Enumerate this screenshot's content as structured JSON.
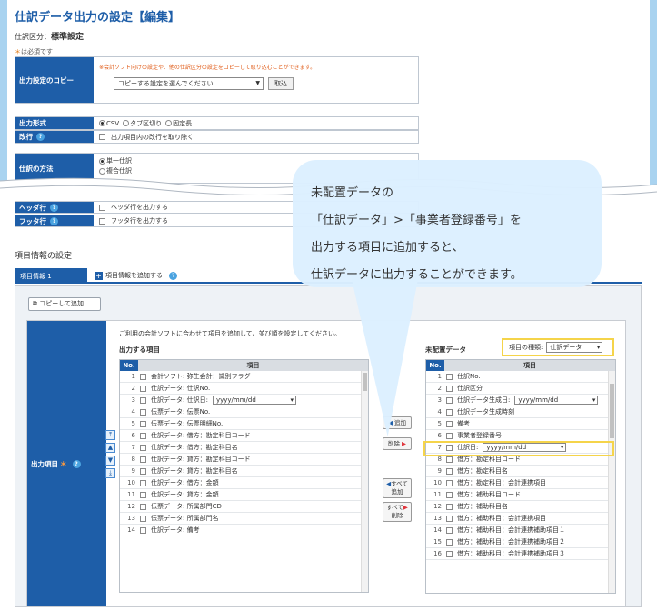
{
  "header": {
    "title": "仕訳データ出力の設定【編集】",
    "category_label": "仕訳区分：",
    "category_value": "標準設定",
    "required_note": "は必須です"
  },
  "copy": {
    "label": "出力設定のコピー",
    "note": "※会計ソフト向けの設定や、他の仕訳区分の設定をコピーして取り込むことができます。",
    "select": "コピーする設定を選んでください",
    "button": "取込"
  },
  "format": {
    "label": "出力形式",
    "opt1": "CSV",
    "opt2": "タブ区切り",
    "opt3": "固定長"
  },
  "linebreak": {
    "label": "改行",
    "checkbox": "出力項目内の改行を取り除く"
  },
  "method": {
    "label": "仕訳の方法",
    "opt1": "単一仕訳",
    "opt2": "複合仕訳"
  },
  "header_row": {
    "label": "ヘッダ行",
    "checkbox": "ヘッダ行を出力する"
  },
  "footer_row": {
    "label": "フッタ行",
    "checkbox": "フッタ行を出力する"
  },
  "items": {
    "section_title": "項目情報の設定",
    "tab": "項目情報 1",
    "add_tab": "項目情報を追加する",
    "copy_add": "コピーして追加",
    "output_label": "出力項目",
    "guide": "ご利用の会計ソフトに合わせて項目を追加して、並び順を設定してください。",
    "left_title": "出力する項目",
    "right_title": "未配置データ",
    "kind_label": "項目の種類:",
    "kind_value": "仕訳データ",
    "col_no": "No.",
    "col_item": "項目"
  },
  "left_rows": [
    {
      "no": "1",
      "text": "会計ソフト: 弥生会計：識別フラグ"
    },
    {
      "no": "2",
      "text": "仕訳データ: 仕訳No."
    },
    {
      "no": "3",
      "text": "仕訳データ: 仕訳日:",
      "date": "yyyy/mm/dd"
    },
    {
      "no": "4",
      "text": "伝票データ: 伝票No."
    },
    {
      "no": "5",
      "text": "伝票データ: 伝票明細No."
    },
    {
      "no": "6",
      "text": "仕訳データ: 借方：勘定科目コード"
    },
    {
      "no": "7",
      "text": "仕訳データ: 借方：勘定科目名"
    },
    {
      "no": "8",
      "text": "仕訳データ: 貸方：勘定科目コード"
    },
    {
      "no": "9",
      "text": "仕訳データ: 貸方：勘定科目名"
    },
    {
      "no": "10",
      "text": "仕訳データ: 借方：金額"
    },
    {
      "no": "11",
      "text": "仕訳データ: 貸方：金額"
    },
    {
      "no": "12",
      "text": "伝票データ: 所属部門CD"
    },
    {
      "no": "13",
      "text": "伝票データ: 所属部門名"
    },
    {
      "no": "14",
      "text": "仕訳データ: 備考"
    }
  ],
  "right_rows": [
    {
      "no": "1",
      "text": "仕訳No."
    },
    {
      "no": "2",
      "text": "仕訳区分"
    },
    {
      "no": "3",
      "text": "仕訳データ生成日:",
      "date": "yyyy/mm/dd"
    },
    {
      "no": "4",
      "text": "仕訳データ生成時刻"
    },
    {
      "no": "5",
      "text": "備考"
    },
    {
      "no": "6",
      "text": "事業者登録番号"
    },
    {
      "no": "7",
      "text": "仕訳日:",
      "date": "yyyy/mm/dd"
    },
    {
      "no": "8",
      "text": "借方：勘定科目コード"
    },
    {
      "no": "9",
      "text": "借方：勘定科目名"
    },
    {
      "no": "10",
      "text": "借方：勘定科目：会計連携項目"
    },
    {
      "no": "11",
      "text": "借方：補助科目コード"
    },
    {
      "no": "12",
      "text": "借方：補助科目名"
    },
    {
      "no": "13",
      "text": "借方：補助科目：会計連携項目"
    },
    {
      "no": "14",
      "text": "借方：補助科目：会計連携補助項目１"
    },
    {
      "no": "15",
      "text": "借方：補助科目：会計連携補助項目２"
    },
    {
      "no": "16",
      "text": "借方：補助科目：会計連携補助項目３"
    }
  ],
  "buttons": {
    "add": "追加",
    "remove": "削除",
    "add_all_1": "すべて",
    "add_all_2": "追加",
    "remove_all_1": "すべて",
    "remove_all_2": "削除"
  },
  "callout": {
    "line1": "未配置データの",
    "line2": "「仕訳データ」>「事業者登録番号」を",
    "line3": "出力する項目に追加すると、",
    "line4": "仕訳データに出力することができます。"
  }
}
